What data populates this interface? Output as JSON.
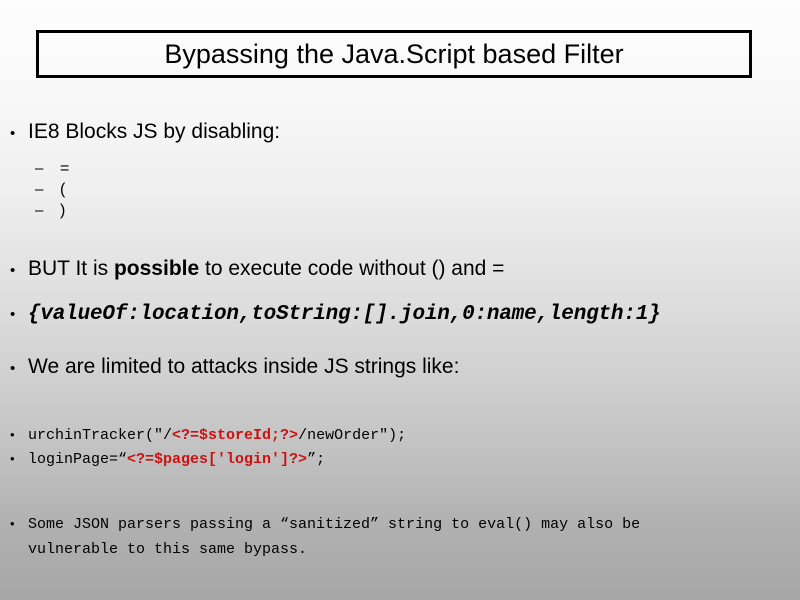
{
  "slide": {
    "title": "Bypassing the Java.Script based Filter",
    "bullets": {
      "b1": "IE8 Blocks JS by disabling:",
      "b1_sub1": "=",
      "b1_sub2": "(",
      "b1_sub3": ")",
      "b2_pre": "BUT It is ",
      "b2_bold": "possible",
      "b2_post": " to execute code without () and =",
      "b3_code": "{valueOf:location,toString:[].join,0:name,length:1}",
      "b4": "We are limited to attacks inside JS strings like:",
      "b5_pre": "urchinTracker(\"/",
      "b5_red": "<?=$storeId;?>",
      "b5_post": "/newOrder\");",
      "b6_pre": "loginPage=“",
      "b6_red": "<?=$pages['login']?>",
      "b6_post": "”;",
      "b7_line1": "Some JSON parsers passing a “sanitized” string to eval()",
      "b7_line2": "may also be vulnerable to this same bypass."
    },
    "markers": {
      "dot": "•",
      "dash": "–"
    },
    "colors": {
      "accent_red": "#cc1111",
      "text": "#000000",
      "bg_top": "#fdfdfd",
      "bg_bottom": "#a6a6a6"
    }
  }
}
